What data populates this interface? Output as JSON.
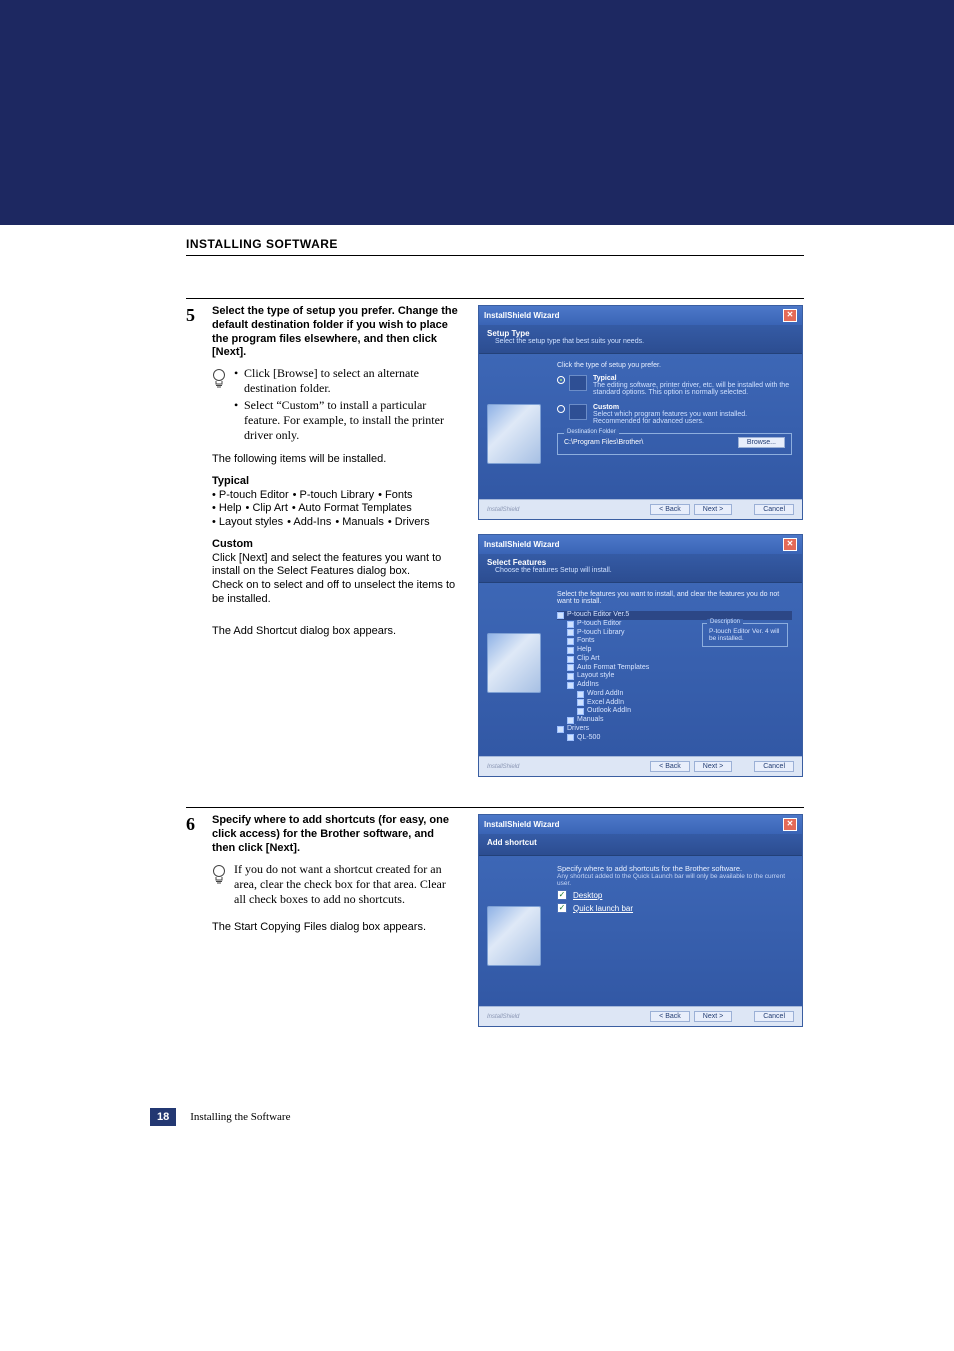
{
  "sectionTitle": "INSTALLING SOFTWARE",
  "step5": {
    "num": "5",
    "heading": "Select the type of setup you prefer. Change the default destination folder if you wish to place the program files elsewhere, and then click [Next].",
    "tip1": "Click [Browse] to select an alternate destination folder.",
    "tip2": "Select “Custom” to install a particular feature. For example, to install the printer driver only.",
    "para1": "The following items will be installed.",
    "typicalHead": "Typical",
    "featureLines": [
      [
        "• P-touch Editor",
        "• P-touch Library",
        "• Fonts"
      ],
      [
        "• Help",
        "• Clip Art",
        "• Auto Format Templates"
      ],
      [
        "• Layout styles",
        "• Add-Ins",
        "• Manuals",
        "• Drivers"
      ]
    ],
    "customHead": "Custom",
    "customPara": "Click [Next] and select the features you want to install on the Select Features dialog box.\nCheck on to select and off to unselect the items to be installed.",
    "para2": "The Add Shortcut dialog box appears."
  },
  "step6": {
    "num": "6",
    "heading": "Specify where to add shortcuts (for easy, one click access) for the Brother software, and then click [Next].",
    "tip": "If you do not want a shortcut created for an area, clear the check box for that area. Clear all check boxes to add no shortcuts.",
    "para": "The Start Copying Files dialog box appears."
  },
  "wizard1": {
    "title": "InstallShield Wizard",
    "headerTitle": "Setup Type",
    "headerSub": "Select the setup type that best suits your needs.",
    "prompt": "Click the type of setup you prefer.",
    "opt1Title": "Typical",
    "opt1Desc": "The editing software, printer driver, etc. will be installed with the standard options. This option is normally selected.",
    "opt2Title": "Custom",
    "opt2Desc": "Select which program features you want installed. Recommended for advanced users.",
    "destLegend": "Destination Folder",
    "destPath": "C:\\Program Files\\Brother\\",
    "browse": "Browse...",
    "brand": "InstallShield",
    "back": "< Back",
    "next": "Next >",
    "cancel": "Cancel"
  },
  "wizard2": {
    "title": "InstallShield Wizard",
    "headerTitle": "Select Features",
    "headerSub": "Choose the features Setup will install.",
    "prompt": "Select the features you want to install, and clear the features you do not want to install.",
    "tree": [
      {
        "label": "P-touch Editor Ver.5",
        "lvl": 0,
        "sel": true
      },
      {
        "label": "P-touch Editor",
        "lvl": 1
      },
      {
        "label": "P-touch Library",
        "lvl": 1
      },
      {
        "label": "Fonts",
        "lvl": 1
      },
      {
        "label": "Help",
        "lvl": 1
      },
      {
        "label": "Clip Art",
        "lvl": 1
      },
      {
        "label": "Auto Format Templates",
        "lvl": 1
      },
      {
        "label": "Layout style",
        "lvl": 1
      },
      {
        "label": "AddIns",
        "lvl": 1
      },
      {
        "label": "Word AddIn",
        "lvl": 2
      },
      {
        "label": "Excel AddIn",
        "lvl": 2
      },
      {
        "label": "Outlook AddIn",
        "lvl": 2
      },
      {
        "label": "Manuals",
        "lvl": 1
      },
      {
        "label": "Drivers",
        "lvl": 0
      },
      {
        "label": "QL-500",
        "lvl": 1
      }
    ],
    "descLegend": "Description",
    "descText": "P-touch Editor Ver. 4 will be installed.",
    "brand": "InstallShield",
    "back": "< Back",
    "next": "Next >",
    "cancel": "Cancel"
  },
  "wizard3": {
    "title": "InstallShield Wizard",
    "headerTitle": "Add shortcut",
    "prompt": "Specify where to add shortcuts for the Brother software.",
    "promptSub": "Any shortcut added to the Quick Launch bar will only be available to the current user.",
    "chk1": "Desktop",
    "chk2": "Quick launch bar",
    "brand": "InstallShield",
    "back": "< Back",
    "next": "Next >",
    "cancel": "Cancel"
  },
  "footer": {
    "pageNum": "18",
    "label": "Installing the Software"
  }
}
